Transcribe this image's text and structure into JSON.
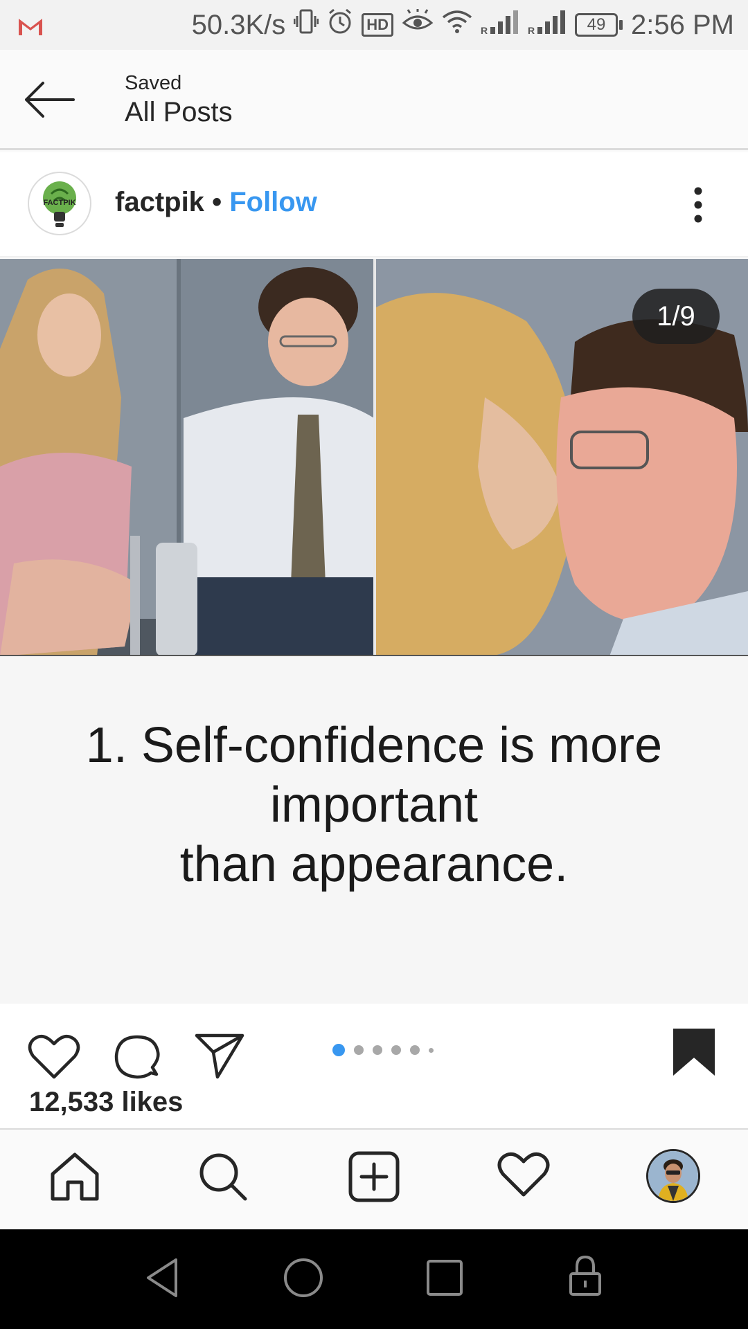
{
  "status_bar": {
    "net_speed": "50.3K/s",
    "hd": "HD",
    "battery": "49",
    "time": "2:56 PM"
  },
  "header": {
    "subtitle": "Saved",
    "title": "All Posts"
  },
  "post": {
    "username": "factpik",
    "separator": "•",
    "follow_label": "Follow",
    "avatar_text": "FACTPIK",
    "counter": "1/9",
    "caption_lines": [
      "1. Self-confidence is more",
      "important",
      "than appearance."
    ],
    "likes": "12,533 likes",
    "carousel_total_dots": 6,
    "carousel_active_index": 0
  },
  "colors": {
    "link": "#3897f0",
    "text": "#262626",
    "muted": "#a8a8a8"
  }
}
